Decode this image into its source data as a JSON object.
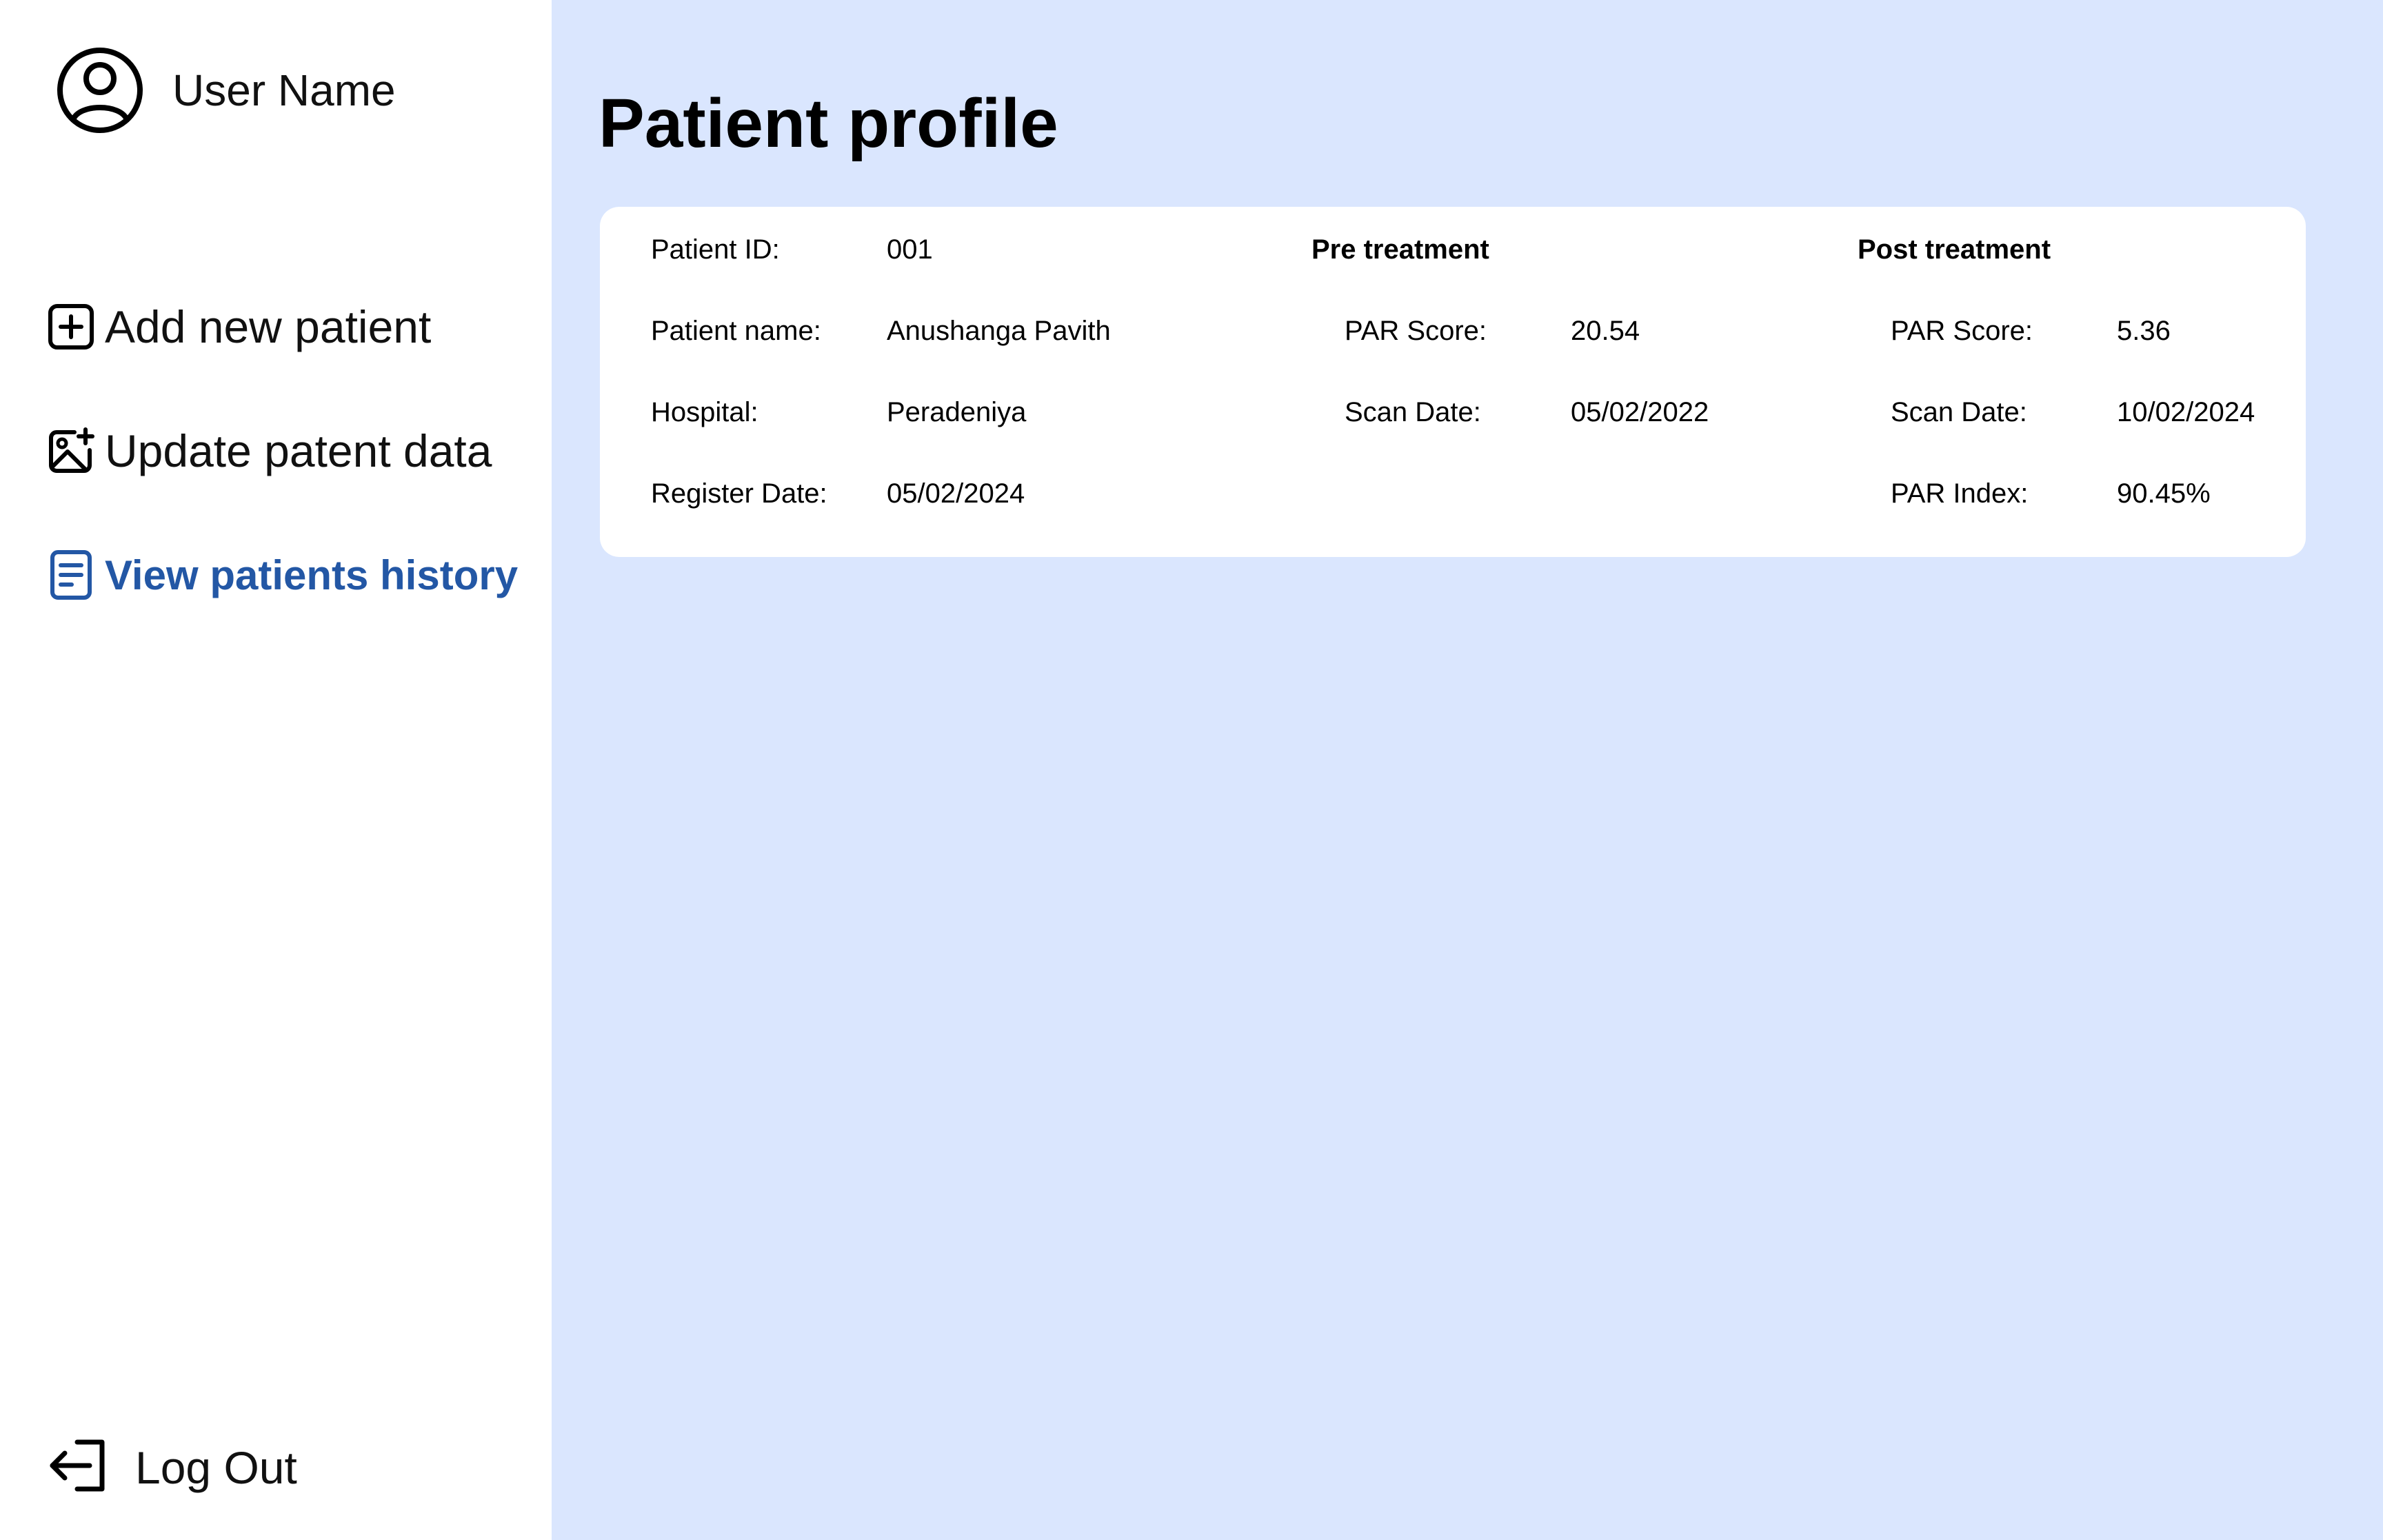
{
  "sidebar": {
    "user_name": "User Name",
    "nav": {
      "add_new_patient": "Add new patient",
      "update_patient_data": "Update patent data",
      "view_patients_history": "View patients history"
    },
    "logout": "Log Out",
    "active_color": "#2357A5"
  },
  "main": {
    "title": "Patient profile",
    "background": "#DAE6FE",
    "patient": {
      "id_label": "Patient ID:",
      "id_value": "001",
      "name_label": "Patient name:",
      "name_value": "Anushanga Pavith",
      "hospital_label": "Hospital:",
      "hospital_value": "Peradeniya",
      "register_label": "Register Date:",
      "register_value": "05/02/2024"
    },
    "pre_treatment": {
      "heading": "Pre treatment",
      "par_score_label": "PAR Score:",
      "par_score_value": "20.54",
      "scan_date_label": "Scan Date:",
      "scan_date_value": "05/02/2022"
    },
    "post_treatment": {
      "heading": "Post treatment",
      "par_score_label": "PAR Score:",
      "par_score_value": "5.36",
      "scan_date_label": "Scan Date:",
      "scan_date_value": "10/02/2024",
      "par_index_label": "PAR Index:",
      "par_index_value": "90.45%"
    }
  },
  "icons": {
    "user": "user-circle-icon",
    "add": "plus-square-icon",
    "update": "image-plus-icon",
    "history": "document-icon",
    "logout": "logout-arrow-icon"
  }
}
